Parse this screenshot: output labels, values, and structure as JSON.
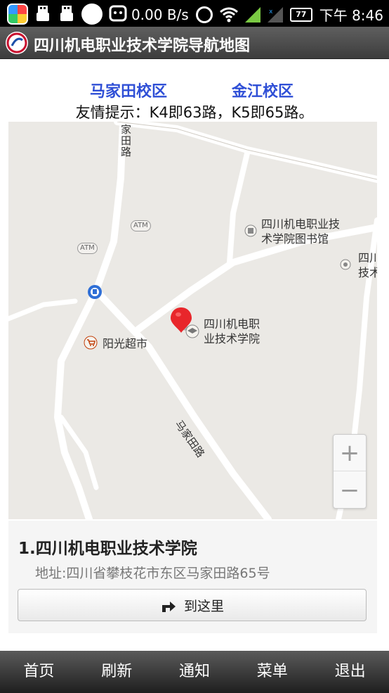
{
  "status_bar": {
    "speed": "0.00 B/s",
    "battery": "77",
    "time": "下午 8:46"
  },
  "header": {
    "title": "四川机电职业技术学院导航地图"
  },
  "campus_links": [
    {
      "label": "马家田校区"
    },
    {
      "label": "金江校区"
    }
  ],
  "tip": "友情提示：K4即63路，K5即65路。",
  "map": {
    "road_labels": [
      "家",
      "田",
      "路",
      "马家田路"
    ],
    "atm_label": "ATM",
    "pois": {
      "library": [
        "四川机电职业技",
        "术学院图书馆"
      ],
      "school": [
        "四川机电职",
        "业技术学院"
      ],
      "supermarket": "阳光超市",
      "edge": [
        "四川",
        "技术"
      ]
    },
    "zoom_in": "+",
    "zoom_out": "−"
  },
  "result": {
    "title": "1.四川机电职业技术学院",
    "address": "地址:四川省攀枝花市东区马家田路65号",
    "route_button": "到这里"
  },
  "bottom_menu": [
    {
      "label": "首页"
    },
    {
      "label": "刷新"
    },
    {
      "label": "通知"
    },
    {
      "label": "菜单"
    },
    {
      "label": "退出"
    }
  ],
  "colors": {
    "link": "#2f4fd6",
    "marker": "#e8262b",
    "map_bg": "#ebe9e5"
  }
}
